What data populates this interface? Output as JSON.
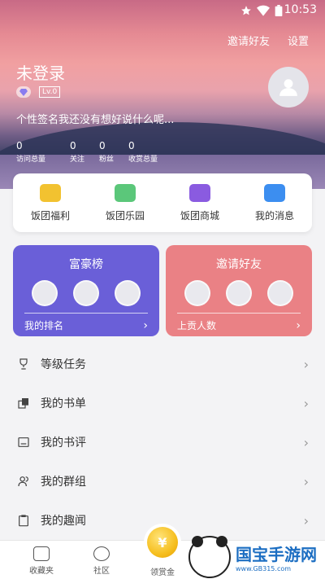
{
  "status_bar": {
    "time": "10:53",
    "icons": [
      "star-icon",
      "wifi-icon",
      "battery-icon"
    ]
  },
  "header": {
    "invite_label": "邀请好友",
    "settings_label": "设置",
    "username": "未登录",
    "level_badge": "Lv.0",
    "signature": "个性签名我还没有想好说什么呢..."
  },
  "stats": [
    {
      "value": "0",
      "label": "访问总量"
    },
    {
      "value": "0",
      "label": "关注"
    },
    {
      "value": "0",
      "label": "粉丝"
    },
    {
      "value": "0",
      "label": "收赏总量"
    }
  ],
  "quick_links": [
    {
      "label": "饭团福利",
      "icon": "gift-icon",
      "color": "#f2c230"
    },
    {
      "label": "饭团乐园",
      "icon": "game-icon",
      "color": "#5bc77a"
    },
    {
      "label": "饭团商城",
      "icon": "shopping-bag-icon",
      "color": "#8a5be0"
    },
    {
      "label": "我的消息",
      "icon": "mail-icon",
      "color": "#3c8ef0"
    }
  ],
  "rank_cards": [
    {
      "title": "富豪榜",
      "footer": "我的排名",
      "color": "#6a5fd8"
    },
    {
      "title": "邀请好友",
      "footer": "上贡人数",
      "color": "#ea8185"
    }
  ],
  "menu": [
    {
      "label": "等级任务",
      "icon": "trophy-icon"
    },
    {
      "label": "我的书单",
      "icon": "booklist-icon"
    },
    {
      "label": "我的书评",
      "icon": "review-icon"
    },
    {
      "label": "我的群组",
      "icon": "group-icon"
    },
    {
      "label": "我的趣闻",
      "icon": "clipboard-icon"
    }
  ],
  "tabbar": {
    "tabs": [
      {
        "label": "收藏夹",
        "icon": "favorites-icon"
      },
      {
        "label": "社区",
        "icon": "community-icon"
      }
    ],
    "center": {
      "label": "领赏金",
      "symbol": "¥"
    }
  },
  "watermark": {
    "main": "国宝手游网",
    "url": "www.GB315.com"
  }
}
